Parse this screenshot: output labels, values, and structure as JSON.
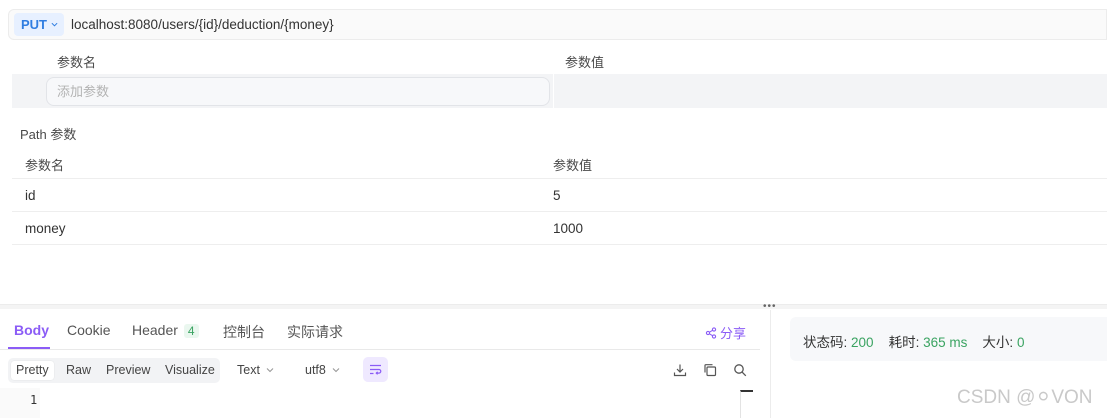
{
  "request": {
    "method": "PUT",
    "url": "localhost:8080/users/{id}/deduction/{money}"
  },
  "query_params": {
    "col_name": "参数名",
    "col_value": "参数值",
    "placeholder": "添加参数"
  },
  "path_params": {
    "title": "Path 参数",
    "col_name": "参数名",
    "col_value": "参数值",
    "rows": [
      {
        "name": "id",
        "value": "5"
      },
      {
        "name": "money",
        "value": "1000"
      }
    ]
  },
  "response": {
    "tabs": [
      {
        "label": "Body",
        "active": true
      },
      {
        "label": "Cookie"
      },
      {
        "label": "Header",
        "badge": "4"
      },
      {
        "label": "控制台"
      },
      {
        "label": "实际请求"
      }
    ],
    "share_label": "分享",
    "formats": [
      "Pretty",
      "Raw",
      "Preview",
      "Visualize"
    ],
    "active_format": "Pretty",
    "content_type": "Text",
    "encoding": "utf8",
    "line_number": "1"
  },
  "status": {
    "code_label": "状态码:",
    "code": "200",
    "time_label": "耗时:",
    "time": "365 ms",
    "size_label": "大小:",
    "size": "0"
  },
  "watermark": "CSDN @⚪VON",
  "colors": {
    "accent": "#8b5cf6",
    "method": "#2f7de1",
    "success": "#3aa361"
  }
}
